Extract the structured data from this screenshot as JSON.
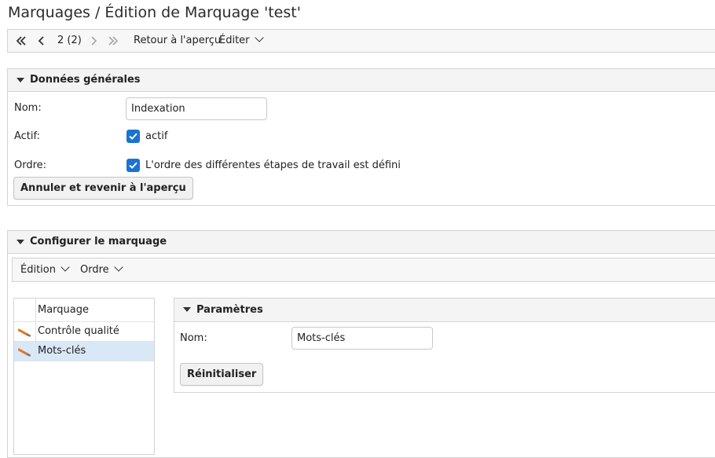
{
  "page": {
    "title": "Marquages / Édition de Marquage 'test'"
  },
  "toolbar": {
    "first_icon": "double-chevron-left-icon",
    "prev_icon": "chevron-left-icon",
    "position": "2 (2)",
    "next_icon": "chevron-right-icon",
    "last_icon": "double-chevron-right-icon",
    "back_label": "Retour à l'aperçu",
    "edit_label": "Éditer"
  },
  "general": {
    "title": "Données générales",
    "name_label": "Nom:",
    "name_value": "Indexation",
    "active_label": "Actif:",
    "active_checked": true,
    "active_text": "actif",
    "order_label": "Ordre:",
    "order_checked": true,
    "order_text": "L'ordre des différentes étapes de travail est défini",
    "cancel_button": "Annuler et revenir à l'aperçu"
  },
  "config": {
    "title": "Configurer le marquage",
    "menu_edition": "Édition",
    "menu_order": "Ordre",
    "grid": {
      "header": "Marquage",
      "rows": [
        {
          "label": "Contrôle qualité",
          "selected": false,
          "icon": "pencil-icon"
        },
        {
          "label": "Mots-clés",
          "selected": true,
          "icon": "pencil-icon"
        }
      ]
    },
    "params": {
      "title": "Paramètres",
      "name_label": "Nom:",
      "name_value": "Mots-clés",
      "reset_button": "Réinitialiser"
    }
  },
  "colors": {
    "accent": "#1a73d2",
    "selected_row": "#d9e8f7",
    "panel_header": "#f4f4f4"
  }
}
